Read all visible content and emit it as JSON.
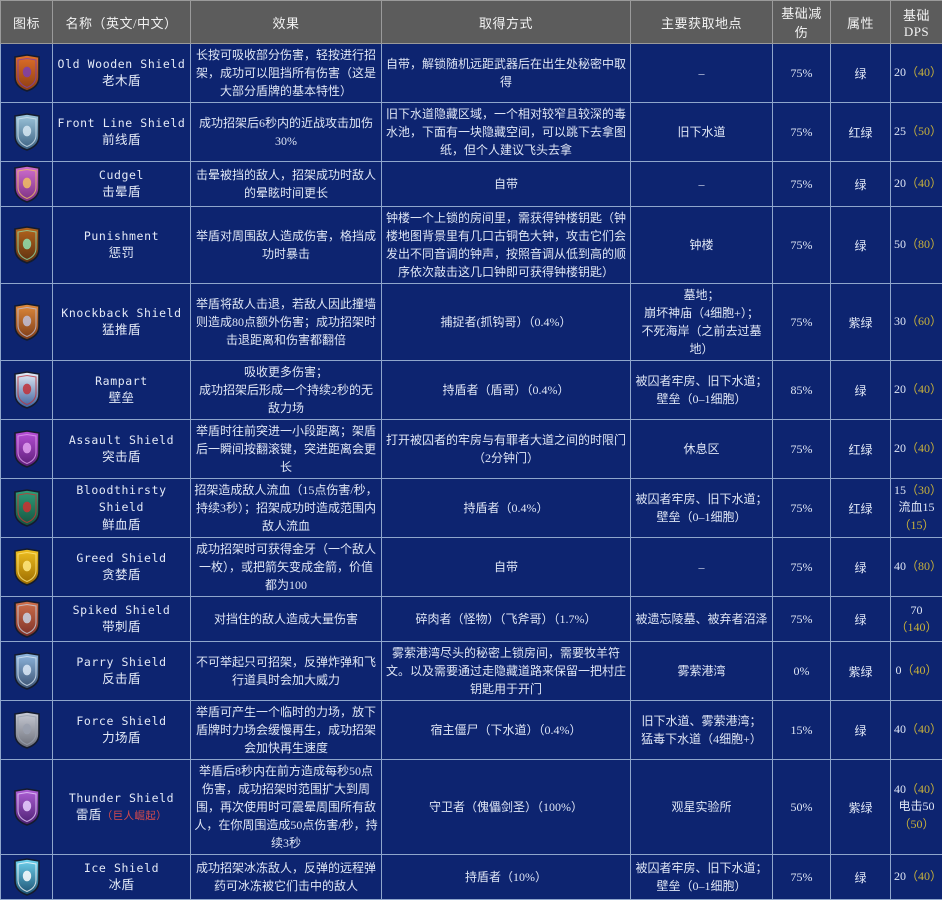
{
  "table": {
    "columns": [
      {
        "key": "icon",
        "label": "图标"
      },
      {
        "key": "name",
        "label": "名称（英文/中文）"
      },
      {
        "key": "effect",
        "label": "效果"
      },
      {
        "key": "obtain",
        "label": "取得方式"
      },
      {
        "key": "loc",
        "label": "主要获取地点"
      },
      {
        "key": "dr",
        "label": "基础减伤"
      },
      {
        "key": "attr",
        "label": "属性"
      },
      {
        "key": "dps",
        "label": "基础DPS"
      }
    ],
    "colors": {
      "header_bg": "#5c5c5c",
      "row_bg": "#0d2470",
      "grid": "#8fa6cc",
      "text": "#e1e8f6",
      "upgrade_value": "#c9b23a",
      "dlc_tag": "#d94b4b"
    },
    "rows": [
      {
        "icon_name": "old-wooden-shield-icon",
        "name_en": "Old Wooden Shield",
        "name_cn": "老木盾",
        "name_tag": "",
        "effect": "长按可吸收部分伤害，轻按进行招架，成功可以阻挡所有伤害（这是大部分盾牌的基本特性）",
        "obtain": "自带，解锁随机远距武器后在出生处秘密中取得",
        "loc": "–",
        "dr": "75%",
        "attr": "绿",
        "dps": [
          {
            "base": "20",
            "upg": "（40）"
          }
        ]
      },
      {
        "icon_name": "front-line-shield-icon",
        "name_en": "Front Line Shield",
        "name_cn": "前线盾",
        "name_tag": "",
        "effect": "成功招架后6秒内的近战攻击加伤30%",
        "obtain": "旧下水道隐藏区域，一个相对较窄且较深的毒水池，下面有一块隐藏空间，可以跳下去拿图纸，但个人建议飞头去拿",
        "loc": "旧下水道",
        "dr": "75%",
        "attr": "红绿",
        "dps": [
          {
            "base": "25",
            "upg": "（50）"
          }
        ]
      },
      {
        "icon_name": "cudgel-shield-icon",
        "name_en": "Cudgel",
        "name_cn": "击晕盾",
        "name_tag": "",
        "effect": "击晕被挡的敌人，招架成功时敌人的晕眩时间更长",
        "obtain": "自带",
        "loc": "–",
        "dr": "75%",
        "attr": "绿",
        "dps": [
          {
            "base": "20",
            "upg": "（40）"
          }
        ]
      },
      {
        "icon_name": "punishment-shield-icon",
        "name_en": "Punishment",
        "name_cn": "惩罚",
        "name_tag": "",
        "effect": "举盾对周围敌人造成伤害，格挡成功时暴击",
        "obtain": "钟楼一个上锁的房间里，需获得钟楼钥匙（钟楼地图背景里有几口古铜色大钟，攻击它们会发出不同音调的钟声，按照音调从低到高的顺序依次敲击这几口钟即可获得钟楼钥匙）",
        "loc": "钟楼",
        "dr": "75%",
        "attr": "绿",
        "dps": [
          {
            "base": "50",
            "upg": "（80）"
          }
        ]
      },
      {
        "icon_name": "knockback-shield-icon",
        "name_en": "Knockback Shield",
        "name_cn": "猛推盾",
        "name_tag": "",
        "effect": "举盾将敌人击退，若敌人因此撞墙则造成80点额外伤害；成功招架时击退距离和伤害都翻倍",
        "obtain": "捕捉者(抓钩哥）（0.4%）",
        "loc": "墓地；\n崩坏神庙（4细胞+）；\n不死海岸（之前去过墓地）",
        "dr": "75%",
        "attr": "紫绿",
        "dps": [
          {
            "base": "30",
            "upg": "（60）"
          }
        ]
      },
      {
        "icon_name": "rampart-shield-icon",
        "name_en": "Rampart",
        "name_cn": "壁垒",
        "name_tag": "",
        "effect": "吸收更多伤害；\n成功招架后形成一个持续2秒的无敌力场",
        "obtain": "持盾者（盾哥）（0.4%）",
        "loc": "被囚者牢房、旧下水道；\n壁垒（0–1细胞）",
        "dr": "85%",
        "attr": "绿",
        "dps": [
          {
            "base": "20",
            "upg": "（40）"
          }
        ]
      },
      {
        "icon_name": "assault-shield-icon",
        "name_en": "Assault Shield",
        "name_cn": "突击盾",
        "name_tag": "",
        "effect": "举盾时往前突进一小段距离；架盾后一瞬间按翻滚键，突进距离会更长",
        "obtain": "打开被囚者的牢房与有罪者大道之间的时限门（2分钟门）",
        "loc": "休息区",
        "dr": "75%",
        "attr": "红绿",
        "dps": [
          {
            "base": "20",
            "upg": "（40）"
          }
        ]
      },
      {
        "icon_name": "bloodthirsty-shield-icon",
        "name_en": "Bloodthirsty Shield",
        "name_cn": "鲜血盾",
        "name_tag": "",
        "effect": "招架造成敌人流血（15点伤害/秒，持续3秒）；招架成功时造成范围内敌人流血",
        "obtain": "持盾者（0.4%）",
        "loc": "被囚者牢房、旧下水道；\n壁垒（0–1细胞）",
        "dr": "75%",
        "attr": "红绿",
        "dps": [
          {
            "base": "15",
            "upg": "（30）"
          },
          {
            "base": "流血15",
            "upg": ""
          },
          {
            "base": "",
            "upg": "（15）"
          }
        ]
      },
      {
        "icon_name": "greed-shield-icon",
        "name_en": "Greed Shield",
        "name_cn": "贪婪盾",
        "name_tag": "",
        "effect": "成功招架时可获得金牙（一个敌人一枚），或把箭矢变成金箭，价值都为100",
        "obtain": "自带",
        "loc": "–",
        "dr": "75%",
        "attr": "绿",
        "dps": [
          {
            "base": "40",
            "upg": "（80）"
          }
        ]
      },
      {
        "icon_name": "spiked-shield-icon",
        "name_en": "Spiked Shield",
        "name_cn": "带刺盾",
        "name_tag": "",
        "effect": "对挡住的敌人造成大量伤害",
        "obtain": "碎肉者（怪物）（飞斧哥）（1.7%）",
        "loc": "被遗忘陵墓、被弃者沼泽",
        "dr": "75%",
        "attr": "绿",
        "dps": [
          {
            "base": "70",
            "upg": ""
          },
          {
            "base": "",
            "upg": "（140）"
          }
        ]
      },
      {
        "icon_name": "parry-shield-icon",
        "name_en": "Parry Shield",
        "name_cn": "反击盾",
        "name_tag": "",
        "effect": "不可举起只可招架，反弹炸弹和飞行道具时会加大威力",
        "obtain": "雾萦港湾尽头的秘密上锁房间，需要牧羊符文。以及需要通过走隐藏道路来保留一把村庄钥匙用于开门",
        "loc": "雾萦港湾",
        "dr": "0%",
        "attr": "紫绿",
        "dps": [
          {
            "base": "0",
            "upg": "（40）"
          }
        ]
      },
      {
        "icon_name": "force-shield-icon",
        "name_en": "Force Shield",
        "name_cn": "力场盾",
        "name_tag": "",
        "effect": "举盾可产生一个临时的力场，放下盾牌时力场会缓慢再生，成功招架会加快再生速度",
        "obtain": "宿主僵尸（下水道）（0.4%）",
        "loc": "旧下水道、雾萦港湾；\n猛毒下水道（4细胞+）",
        "dr": "15%",
        "attr": "绿",
        "dps": [
          {
            "base": "40",
            "upg": "（40）"
          }
        ]
      },
      {
        "icon_name": "thunder-shield-icon",
        "name_en": "Thunder Shield",
        "name_cn": "雷盾",
        "name_tag": "（巨人崛起）",
        "effect": "举盾后8秒内在前方造成每秒50点伤害，成功招架时范围扩大到周围，再次使用时可震晕周围所有敌人，在你周围造成50点伤害/秒，持续3秒",
        "obtain": "守卫者（傀儡剑圣）（100%）",
        "loc": "观星实验所",
        "dr": "50%",
        "attr": "紫绿",
        "dps": [
          {
            "base": "40",
            "upg": "（40）"
          },
          {
            "base": "电击50",
            "upg": ""
          },
          {
            "base": "",
            "upg": "（50）"
          }
        ]
      },
      {
        "icon_name": "ice-shield-icon",
        "name_en": "Ice Shield",
        "name_cn": "冰盾",
        "name_tag": "",
        "effect": "成功招架冰冻敌人，反弹的远程弹药可冰冻被它们击中的敌人",
        "obtain": "持盾者（10%）",
        "loc": "被囚者牢房、旧下水道；\n壁垒（0–1细胞）",
        "dr": "75%",
        "attr": "绿",
        "dps": [
          {
            "base": "20",
            "upg": "（40）"
          }
        ]
      }
    ]
  }
}
